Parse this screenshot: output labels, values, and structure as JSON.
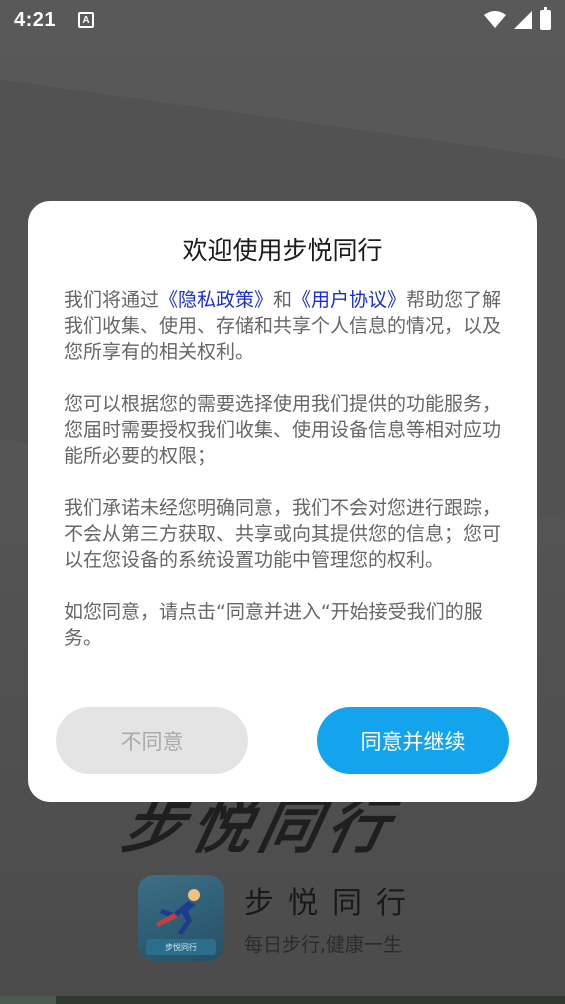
{
  "status_bar": {
    "time": "4:21",
    "notification_icon_letter": "A",
    "icons": [
      "wifi-icon",
      "signal-icon",
      "battery-charging-icon"
    ]
  },
  "background_app": {
    "brand_big": "步悦同行",
    "logo_text": "步悦同行",
    "app_name": "步悦同行",
    "slogan": "每日步行,健康一生"
  },
  "dialog": {
    "title": "欢迎使用步悦同行",
    "p1": {
      "before": "我们将通过",
      "link1": "《隐私政策》",
      "middle": "和",
      "link2": "《用户协议》",
      "after": "帮助您了解我们收集、使用、存储和共享个人信息的情况，以及您所享有的相关权利。"
    },
    "p2": "您可以根据您的需要选择使用我们提供的功能服务，您届时需要授权我们收集、使用设备信息等相对应功能所必要的权限；",
    "p3": "我们承诺未经您明确同意，我们不会对您进行跟踪，不会从第三方获取、共享或向其提供您的信息；您可以在您设备的系统设置功能中管理您的权利。",
    "p4": "如您同意，请点击“同意并进入“开始接受我们的服务。",
    "disagree_label": "不同意",
    "agree_label": "同意并继续"
  },
  "colors": {
    "accent": "#14a4ee",
    "link": "#1a2ed6",
    "overlay": "#555555"
  }
}
